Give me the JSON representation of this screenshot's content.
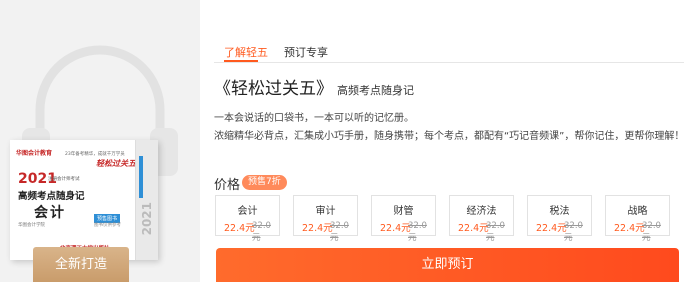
{
  "left": {
    "book": {
      "logo": "华图会计教育",
      "slogan": "23年备考精华，成就千万学员",
      "calligraphy": "轻松过关五",
      "year": "2021",
      "exam": "注册会计师考试",
      "title_line1": "高频考点随身记",
      "title_line2": "会计",
      "tag": "预售图书",
      "tag_sub": "图书仅供参考",
      "publisher": "华图会计学院",
      "spine_year": "2021",
      "bottom_text": "北京理工大学出版社"
    },
    "innovation_label": "全新打造"
  },
  "tabs": [
    {
      "label": "了解轻五",
      "active": true
    },
    {
      "label": "预订专享",
      "active": false
    }
  ],
  "product": {
    "title": "《轻松过关五》",
    "subtitle": "高频考点随身记",
    "desc1": "一本会说话的口袋书，一本可以听的记忆册。",
    "desc2": "浓缩精华必背点，汇集成小巧手册，随身携带；每个考点，都配有“巧记音频课”，帮你记住，更帮你理解！"
  },
  "price": {
    "label": "价格",
    "badge": "预售7折"
  },
  "subjects": [
    {
      "name": "会计",
      "new_price": "22.4元",
      "old_price": "32.0元"
    },
    {
      "name": "审计",
      "new_price": "22.4元",
      "old_price": "32.0元"
    },
    {
      "name": "财管",
      "new_price": "22.4元",
      "old_price": "32.0元"
    },
    {
      "name": "经济法",
      "new_price": "22.4元",
      "old_price": "32.0元"
    },
    {
      "name": "税法",
      "new_price": "22.4元",
      "old_price": "32.0元"
    },
    {
      "name": "战略",
      "new_price": "22.4元",
      "old_price": "32.0元"
    }
  ],
  "buy_label": "立即预订",
  "colors": {
    "accent": "#ff5a1f",
    "gold": "#d2a677",
    "book_blue": "#2e8fd6"
  },
  "icons": [
    "headphone-icon"
  ]
}
